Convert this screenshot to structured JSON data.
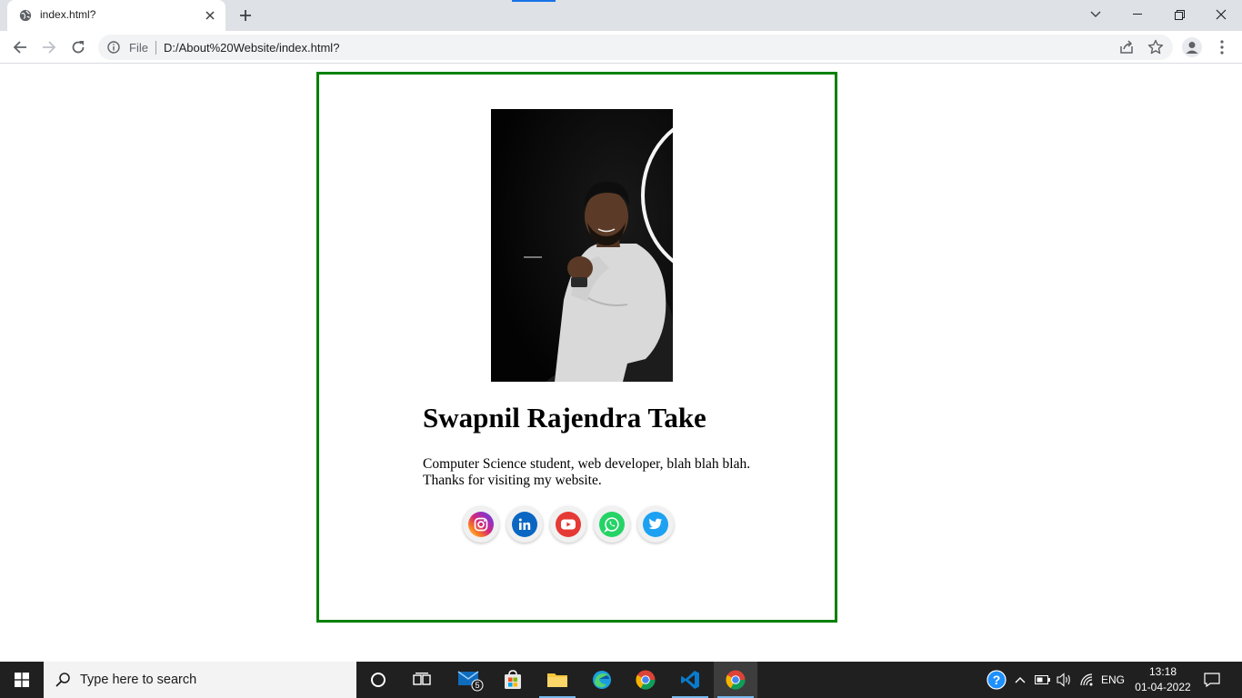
{
  "browser": {
    "tab_title": "index.html?",
    "scheme_label": "File",
    "url": "D:/About%20Website/index.html?"
  },
  "page": {
    "name": "Swapnil Rajendra Take",
    "bio_line1": "Computer Science student, web developer, blah blah blah.",
    "bio_line2": "Thanks for visiting my website.",
    "border_color": "#008000",
    "social_links": [
      {
        "icon": "instagram-icon",
        "color": "#e1306c"
      },
      {
        "icon": "linkedin-icon",
        "color": "#0a66c2"
      },
      {
        "icon": "youtube-icon",
        "color": "#ff0000"
      },
      {
        "icon": "whatsapp-icon",
        "color": "#25d366"
      },
      {
        "icon": "twitter-icon",
        "color": "#1da1f2"
      }
    ]
  },
  "taskbar": {
    "search_placeholder": "Type here to search",
    "mail_badge": "5",
    "language": "ENG",
    "time": "13:18",
    "date": "01-04-2022"
  }
}
